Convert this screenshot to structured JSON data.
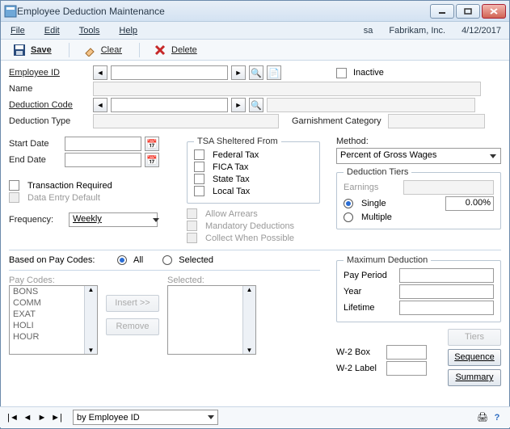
{
  "window": {
    "title": "Employee Deduction Maintenance"
  },
  "status": {
    "user": "sa",
    "company": "Fabrikam, Inc.",
    "date": "4/12/2017"
  },
  "menu": {
    "file": "File",
    "edit": "Edit",
    "tools": "Tools",
    "help": "Help"
  },
  "toolbar": {
    "save": "Save",
    "clear": "Clear",
    "delete": "Delete"
  },
  "fields": {
    "employee_id_label": "Employee ID",
    "name_label": "Name",
    "deduction_code_label": "Deduction Code",
    "deduction_type_label": "Deduction Type",
    "inactive_label": "Inactive",
    "garnishment_category_label": "Garnishment Category"
  },
  "dates": {
    "start_label": "Start Date",
    "end_label": "End Date"
  },
  "options": {
    "transaction_required": "Transaction Required",
    "data_entry_default": "Data Entry Default",
    "frequency_label": "Frequency:",
    "frequency_value": "Weekly"
  },
  "tsa": {
    "legend": "TSA Sheltered From",
    "federal": "Federal Tax",
    "fica": "FICA Tax",
    "state": "State Tax",
    "local": "Local Tax"
  },
  "arrears": {
    "allow": "Allow Arrears",
    "mandatory": "Mandatory Deductions",
    "collect": "Collect When Possible"
  },
  "method": {
    "label": "Method:",
    "value": "Percent of Gross Wages",
    "tiers_legend": "Deduction Tiers",
    "earnings": "Earnings",
    "single": "Single",
    "multiple": "Multiple",
    "single_value": "0.00%"
  },
  "based": {
    "label": "Based on Pay Codes:",
    "all": "All",
    "selected": "Selected"
  },
  "paycodes": {
    "label": "Pay Codes:",
    "items": [
      "BONS",
      "COMM",
      "EXAT",
      "HOLI",
      "HOUR"
    ],
    "selected_label": "Selected:",
    "insert": "Insert >>",
    "remove": "Remove"
  },
  "max": {
    "legend": "Maximum Deduction",
    "pay_period": "Pay Period",
    "year": "Year",
    "lifetime": "Lifetime"
  },
  "w2": {
    "box": "W-2 Box",
    "label": "W-2 Label"
  },
  "buttons": {
    "tiers": "Tiers",
    "sequence": "Sequence",
    "summary": "Summary"
  },
  "footer": {
    "sort": "by Employee ID"
  }
}
